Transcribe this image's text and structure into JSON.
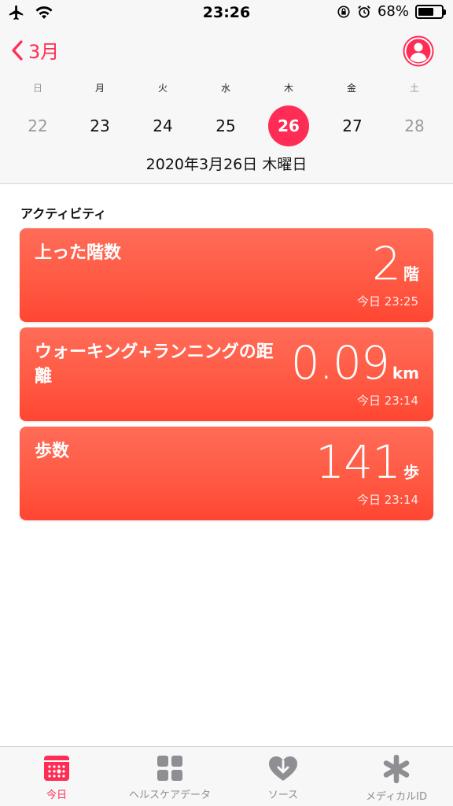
{
  "status_bar": {
    "time": "23:26",
    "battery": "68%",
    "battery_level": 0.68
  },
  "nav": {
    "back_label": "3月"
  },
  "week": {
    "day_names": [
      "日",
      "月",
      "火",
      "水",
      "木",
      "金",
      "土"
    ],
    "days": [
      "22",
      "23",
      "24",
      "25",
      "26",
      "27",
      "28"
    ],
    "selected_index": 4
  },
  "date_line": "2020年3月26日 木曜日",
  "section_title": "アクティビティ",
  "cards": [
    {
      "title": "上った階数",
      "value": "2",
      "unit": "階",
      "time": "今日 23:25"
    },
    {
      "title": "ウォーキング+ランニングの距離",
      "value": "0.09",
      "unit": "km",
      "time": "今日 23:14"
    },
    {
      "title": "歩数",
      "value": "141",
      "unit": "歩",
      "time": "今日 23:14"
    }
  ],
  "tabs": [
    {
      "label": "今日",
      "icon": "calendar-icon",
      "active": true
    },
    {
      "label": "ヘルスケアデータ",
      "icon": "grid-icon",
      "active": false
    },
    {
      "label": "ソース",
      "icon": "heart-download-icon",
      "active": false
    },
    {
      "label": "メディカルID",
      "icon": "asterisk-icon",
      "active": false
    }
  ],
  "colors": {
    "accent": "#ff2d55",
    "card": "#ff5a44"
  }
}
